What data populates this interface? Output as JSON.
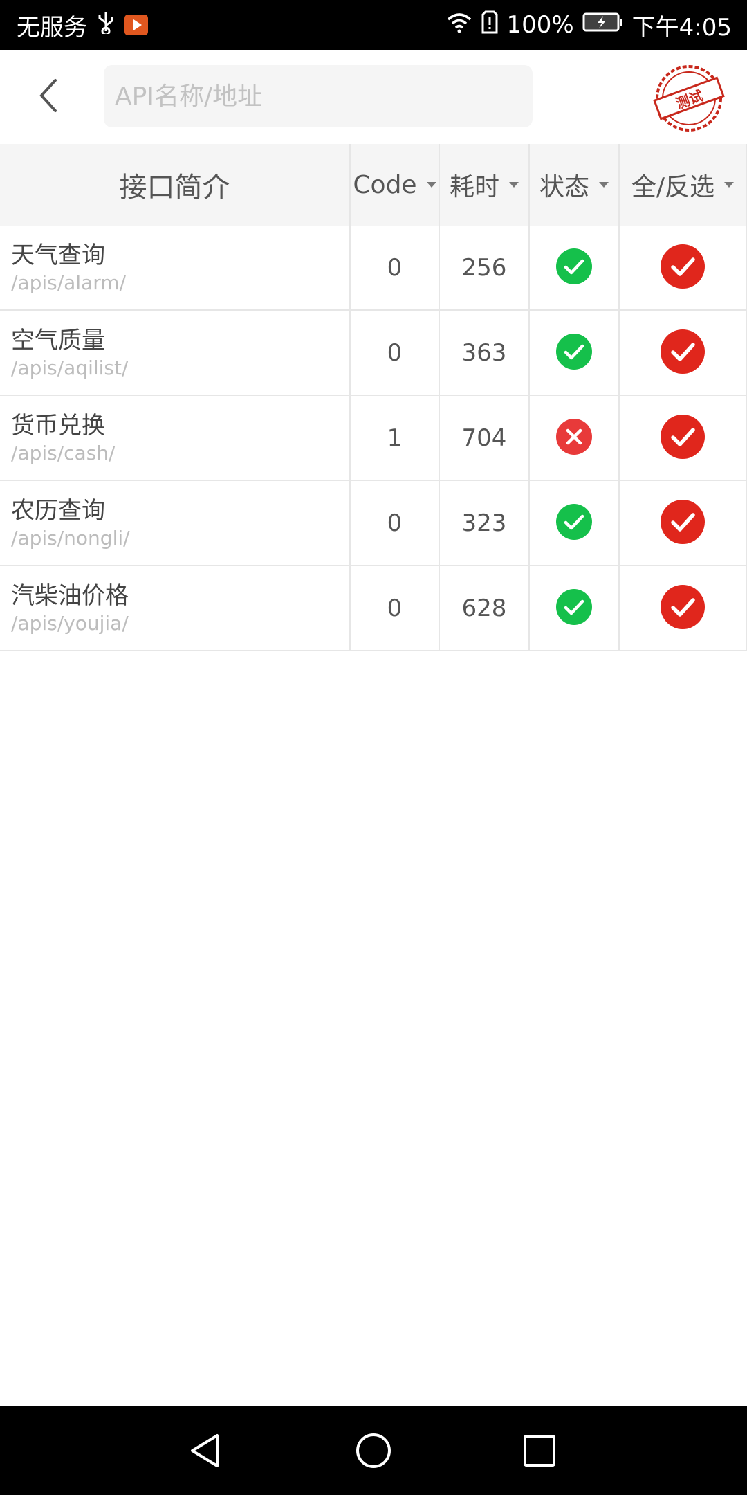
{
  "status_bar": {
    "carrier": "无服务",
    "battery": "100%",
    "time": "下午4:05"
  },
  "header": {
    "search": {
      "placeholder": "API名称/地址",
      "value": ""
    },
    "stamp_text": "测试"
  },
  "table": {
    "columns": {
      "description": "接口简介",
      "code": "Code",
      "duration": "耗时",
      "status": "状态",
      "select": "全/反选"
    },
    "rows": [
      {
        "name": "天气查询",
        "path": "/apis/alarm/",
        "code": "0",
        "duration": "256",
        "status": "success",
        "selected": true
      },
      {
        "name": "空气质量",
        "path": "/apis/aqilist/",
        "code": "0",
        "duration": "363",
        "status": "success",
        "selected": true
      },
      {
        "name": "货币兑换",
        "path": "/apis/cash/",
        "code": "1",
        "duration": "704",
        "status": "fail",
        "selected": true
      },
      {
        "name": "农历查询",
        "path": "/apis/nongli/",
        "code": "0",
        "duration": "323",
        "status": "success",
        "selected": true
      },
      {
        "name": "汽柴油价格",
        "path": "/apis/youjia/",
        "code": "0",
        "duration": "628",
        "status": "success",
        "selected": true
      }
    ]
  },
  "colors": {
    "success": "#15c04b",
    "fail": "#e83a3a",
    "selected": "#e0261c",
    "header_bg": "#f5f5f5",
    "divider": "#e6e6e6"
  },
  "icons": {
    "back": "chevron-left-icon",
    "status_success": "check-circle-icon",
    "status_fail": "x-circle-icon",
    "selected": "check-circle-icon"
  }
}
